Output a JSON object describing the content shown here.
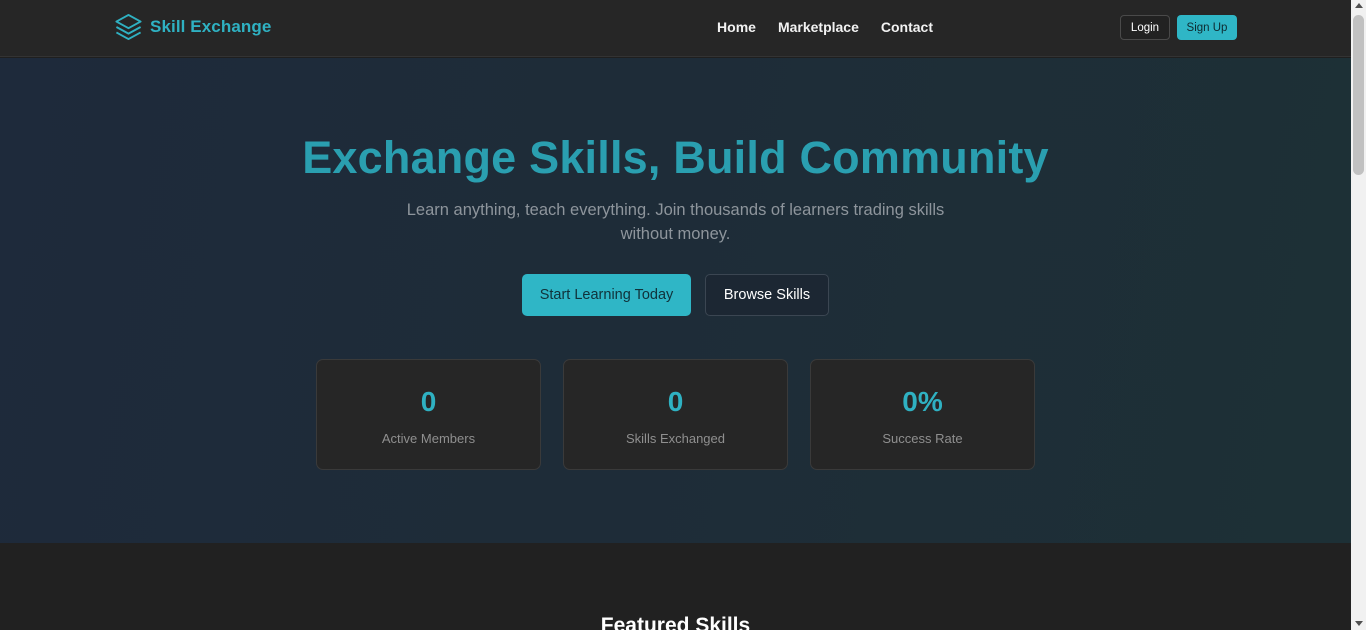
{
  "header": {
    "brand": "Skill Exchange",
    "brand_icon": "layers-icon",
    "nav": [
      "Home",
      "Marketplace",
      "Contact"
    ],
    "login_label": "Login",
    "signup_label": "Sign Up"
  },
  "hero": {
    "title": "Exchange Skills, Build Community",
    "subtitle": "Learn anything, teach everything. Join thousands of learners trading skills without money.",
    "primary_cta": "Start Learning Today",
    "secondary_cta": "Browse Skills",
    "stats": [
      {
        "value": "0",
        "label": "Active Members"
      },
      {
        "value": "0",
        "label": "Skills Exchanged"
      },
      {
        "value": "0%",
        "label": "Success Rate"
      }
    ]
  },
  "featured": {
    "title": "Featured Skills"
  },
  "colors": {
    "accent": "#2fb6c6",
    "header_bg": "#262626",
    "hero_bg_start": "#1e2a3b",
    "hero_bg_end": "#1d3036"
  }
}
